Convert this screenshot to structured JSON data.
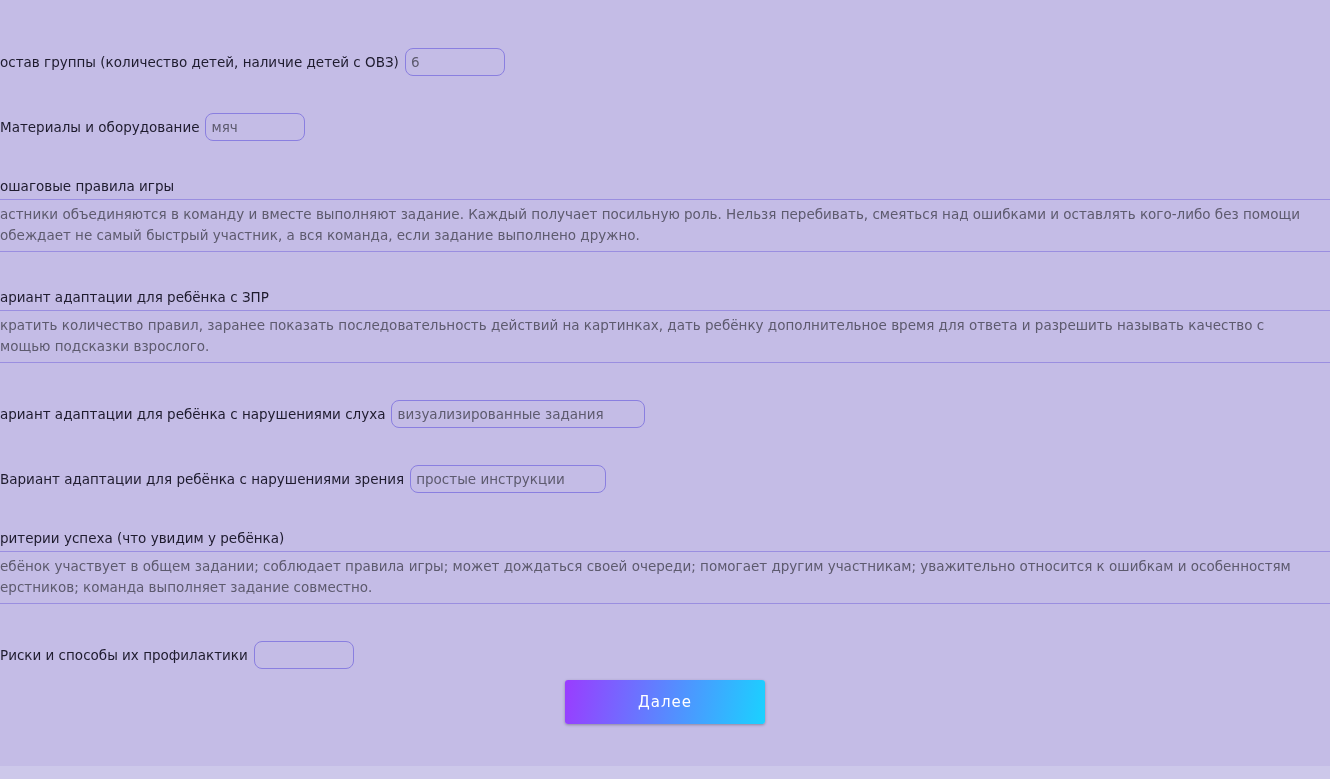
{
  "form": {
    "fields": [
      {
        "kind": "input",
        "label": "остав группы (количество детей, наличие детей с ОВЗ)",
        "value": "6"
      },
      {
        "kind": "input",
        "label": "Материалы и оборудование",
        "value": "мяч"
      },
      {
        "kind": "textarea",
        "label": "ошаговые правила игры",
        "lines": [
          "астники объединяются в команду и вместе выполняют задание. Каждый получает посильную роль. Нельзя перебивать, смеяться над ошибками и оставлять кого-либо без помощи",
          "обеждает не самый быстрый участник, а вся команда, если задание выполнено дружно."
        ]
      },
      {
        "kind": "textarea",
        "label": "ариант адаптации для ребёнка с ЗПР",
        "lines": [
          "кратить количество правил, заранее показать последовательность действий на картинках, дать ребёнку дополнительное время для ответа и разрешить называть качество с",
          "мощью подсказки взрослого."
        ]
      },
      {
        "kind": "input",
        "label": "ариант адаптации для ребёнка с нарушениями слуха",
        "value": "визуализированные задания"
      },
      {
        "kind": "input",
        "label": "Вариант адаптации для ребёнка с нарушениями зрения",
        "value": "простые инструкции"
      },
      {
        "kind": "textarea",
        "label": "ритерии успеха (что увидим у ребёнка)",
        "lines": [
          "ебёнок участвует в общем задании; соблюдает правила игры; может дождаться своей очереди; помогает другим участникам; уважительно относится к ошибкам и особенностям",
          "ерстников; команда выполняет задание совместно."
        ]
      },
      {
        "kind": "input",
        "label": "Риски и способы их профилактики"
      }
    ],
    "next_button": "Далее"
  }
}
